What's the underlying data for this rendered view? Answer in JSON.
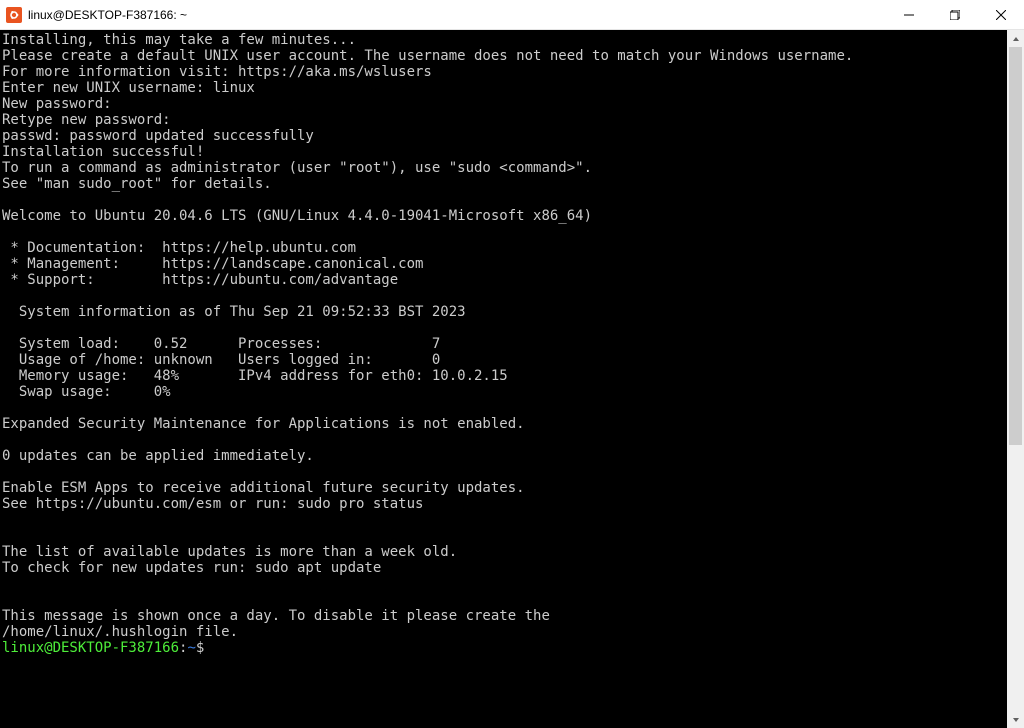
{
  "window": {
    "title": "linux@DESKTOP-F387166: ~"
  },
  "terminal": {
    "lines": [
      "Installing, this may take a few minutes...",
      "Please create a default UNIX user account. The username does not need to match your Windows username.",
      "For more information visit: https://aka.ms/wslusers",
      "Enter new UNIX username: linux",
      "New password:",
      "Retype new password:",
      "passwd: password updated successfully",
      "Installation successful!",
      "To run a command as administrator (user \"root\"), use \"sudo <command>\".",
      "See \"man sudo_root\" for details.",
      "",
      "Welcome to Ubuntu 20.04.6 LTS (GNU/Linux 4.4.0-19041-Microsoft x86_64)",
      "",
      " * Documentation:  https://help.ubuntu.com",
      " * Management:     https://landscape.canonical.com",
      " * Support:        https://ubuntu.com/advantage",
      "",
      "  System information as of Thu Sep 21 09:52:33 BST 2023",
      "",
      "  System load:    0.52      Processes:             7",
      "  Usage of /home: unknown   Users logged in:       0",
      "  Memory usage:   48%       IPv4 address for eth0: 10.0.2.15",
      "  Swap usage:     0%",
      "",
      "Expanded Security Maintenance for Applications is not enabled.",
      "",
      "0 updates can be applied immediately.",
      "",
      "Enable ESM Apps to receive additional future security updates.",
      "See https://ubuntu.com/esm or run: sudo pro status",
      "",
      "",
      "The list of available updates is more than a week old.",
      "To check for new updates run: sudo apt update",
      "",
      "",
      "This message is shown once a day. To disable it please create the",
      "/home/linux/.hushlogin file."
    ],
    "prompt": {
      "user_host": "linux@DESKTOP-F387166",
      "colon": ":",
      "path": "~",
      "dollar": "$"
    }
  }
}
